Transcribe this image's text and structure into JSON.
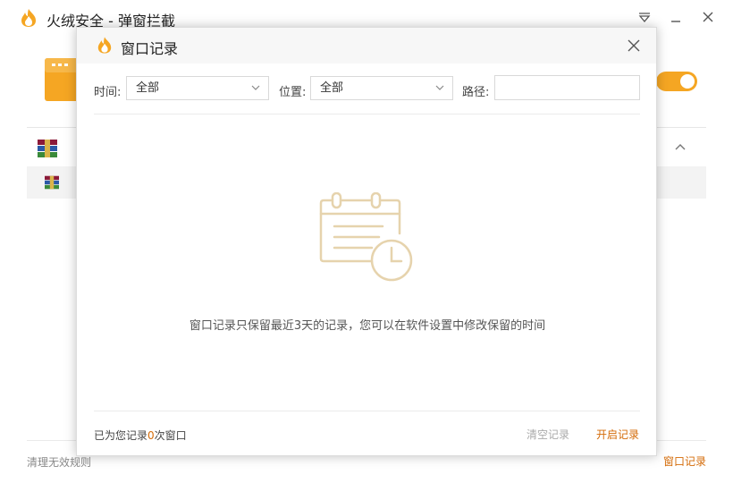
{
  "app": {
    "title": "火绒安全 - 弹窗拦截",
    "brand_color": "#f5a623",
    "accent_text_color": "#d46b08",
    "bottom": {
      "clear_rules": "清理无效规则",
      "window_records": "窗口记录"
    },
    "toggle_on": true
  },
  "dialog": {
    "title": "窗口记录",
    "filters": {
      "time_label": "时间:",
      "time_value": "全部",
      "position_label": "位置:",
      "position_value": "全部",
      "path_label": "路径:",
      "path_value": ""
    },
    "empty_message": "窗口记录只保留最近3天的记录，您可以在软件设置中修改保留的时间",
    "summary_prefix": "已为您记录",
    "summary_count": "0",
    "summary_suffix": "次窗口",
    "clear_button": "清空记录",
    "start_button": "开启记录",
    "icons": {
      "logo": "huorong-flame-icon",
      "close": "close-icon",
      "chevron": "chevron-down-icon",
      "empty": "calendar-clock-icon"
    }
  }
}
